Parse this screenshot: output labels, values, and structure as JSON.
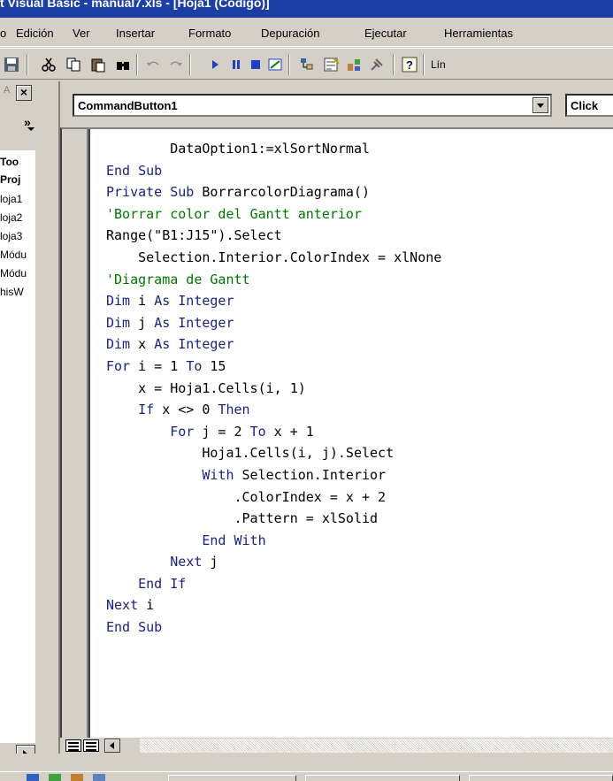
{
  "window": {
    "title": "t Visual Basic - manual7.xls - [Hoja1 (Código)]"
  },
  "menu": {
    "items": [
      "o",
      "Edición",
      "Ver",
      "Insertar",
      "Formato",
      "Depuración",
      "Ejecutar",
      "Herramientas"
    ]
  },
  "toolbar": {
    "line_label": "Lín",
    "icons": [
      "save-icon",
      "cut-icon",
      "copy-icon",
      "paste-icon",
      "find-icon",
      "undo-icon",
      "redo-icon",
      "run-icon",
      "break-icon",
      "reset-icon",
      "design-mode-icon",
      "project-explorer-icon",
      "properties-icon",
      "object-browser-icon",
      "toolbox-icon",
      "help-icon"
    ]
  },
  "left_panel": {
    "tree_items": [
      "Too",
      "Proj",
      "loja1",
      "loja2",
      "loja3",
      "Módu",
      "Módu",
      "hisW"
    ]
  },
  "code_window": {
    "object_combo": "CommandButton1",
    "procedure_combo": "Click",
    "code_lines": [
      {
        "indent": "        ",
        "text": "DataOption1:=xlSortNormal",
        "kind": "code"
      },
      {
        "indent": "",
        "text": "End Sub",
        "kind": "kw"
      },
      {
        "indent": "",
        "text": "",
        "kind": "code"
      },
      {
        "indent": "",
        "text": "Private Sub BorrarcolorDiagrama()",
        "kind": "mixed-private"
      },
      {
        "indent": "",
        "text": "",
        "kind": "code"
      },
      {
        "indent": "",
        "text": "'Borrar color del Gantt anterior",
        "kind": "comment"
      },
      {
        "indent": "",
        "text": "Range(\"B1:J15\").Select",
        "kind": "code"
      },
      {
        "indent": "    ",
        "text": "Selection.Interior.ColorIndex = xlNone",
        "kind": "code"
      },
      {
        "indent": "",
        "text": "",
        "kind": "code"
      },
      {
        "indent": "",
        "text": "'Diagrama de Gantt",
        "kind": "comment"
      },
      {
        "indent": "",
        "text": "Dim i As Integer",
        "kind": "dim"
      },
      {
        "indent": "",
        "text": "Dim j As Integer",
        "kind": "dim"
      },
      {
        "indent": "",
        "text": "Dim x As Integer",
        "kind": "dim"
      },
      {
        "indent": "",
        "text": "For i = 1 To 15",
        "kind": "for"
      },
      {
        "indent": "    ",
        "text": "x = Hoja1.Cells(i, 1)",
        "kind": "code"
      },
      {
        "indent": "    ",
        "text": "If x <> 0 Then",
        "kind": "if"
      },
      {
        "indent": "        ",
        "text": "For j = 2 To x + 1",
        "kind": "for"
      },
      {
        "indent": "            ",
        "text": "Hoja1.Cells(i, j).Select",
        "kind": "code"
      },
      {
        "indent": "            ",
        "text": "With Selection.Interior",
        "kind": "with"
      },
      {
        "indent": "                ",
        "text": ".ColorIndex = x + 2",
        "kind": "code"
      },
      {
        "indent": "                ",
        "text": ".Pattern = xlSolid",
        "kind": "code"
      },
      {
        "indent": "            ",
        "text": "End With",
        "kind": "kw"
      },
      {
        "indent": "        ",
        "text": "Next j",
        "kind": "next"
      },
      {
        "indent": "    ",
        "text": "End If",
        "kind": "kw"
      },
      {
        "indent": "",
        "text": "Next i",
        "kind": "next"
      },
      {
        "indent": "",
        "text": "",
        "kind": "code"
      },
      {
        "indent": "",
        "text": "End Sub",
        "kind": "kw"
      }
    ]
  },
  "colors": {
    "keyword": "#1a237e",
    "comment": "#007700",
    "title_bar": "#1c3fa6"
  }
}
